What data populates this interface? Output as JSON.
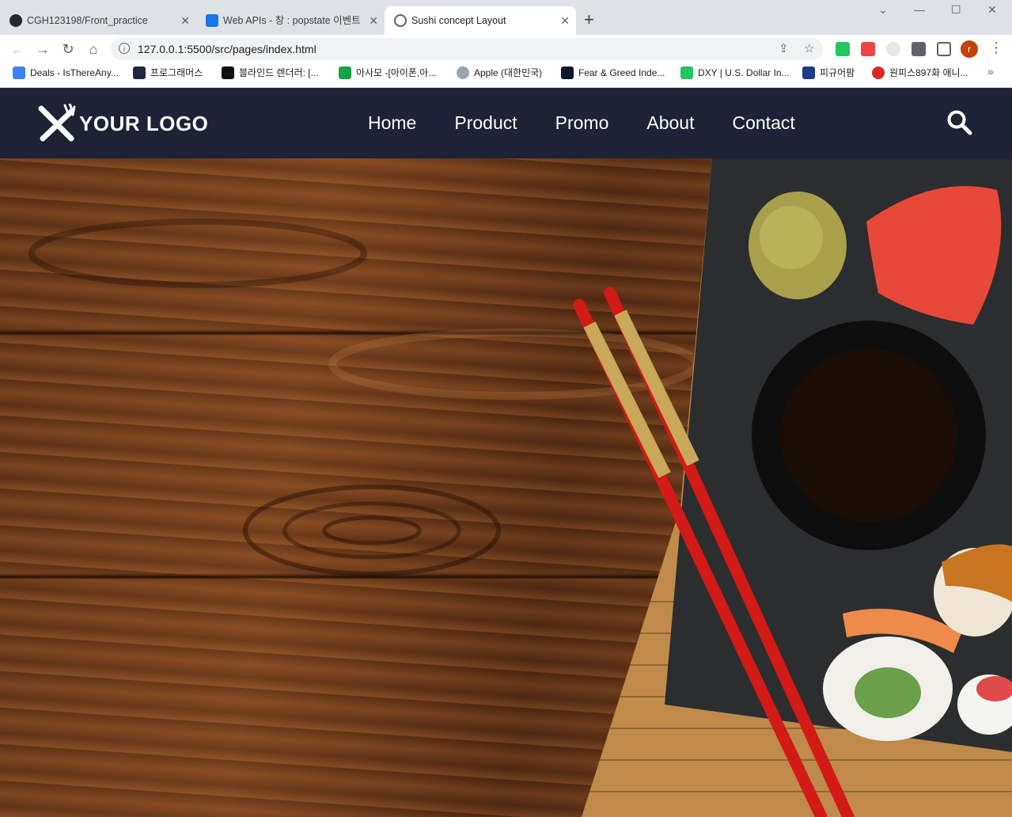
{
  "browser": {
    "tabs": [
      {
        "title": "CGH123198/Front_practice",
        "favicon_color": "#24292f",
        "active": false
      },
      {
        "title": "Web APIs - 창 : popstate 이벤트",
        "favicon_color": "#1a73e8",
        "active": false
      },
      {
        "title": "Sushi concept Layout",
        "favicon_color": "#5f6368",
        "active": true
      }
    ],
    "new_tab_label": "+",
    "window_controls": {
      "dropdown": "⌄",
      "minimize": "—",
      "maximize": "☐",
      "close": "✕"
    },
    "url": "127.0.0.1:5500/src/pages/index.html",
    "profile_initial": "r",
    "bookmarks": [
      {
        "label": "Deals - IsThereAny...",
        "icon_color": "#3b82f6"
      },
      {
        "label": "프로그래머스",
        "icon_color": "#1e293b"
      },
      {
        "label": "블라인드 렌더러: [...",
        "icon_color": "#111111"
      },
      {
        "label": "아사모 -[아이폰,아...",
        "icon_color": "#16a34a"
      },
      {
        "label": "Apple (대한민국)",
        "icon_color": "#9ca3af"
      },
      {
        "label": "Fear & Greed Inde...",
        "icon_color": "#0f172a"
      },
      {
        "label": "DXY | U.S. Dollar In...",
        "icon_color": "#22c55e"
      },
      {
        "label": "피규어팜",
        "icon_color": "#1e3a8a"
      },
      {
        "label": "원피스897화 애니...",
        "icon_color": "#dc2626"
      }
    ],
    "bookmarks_more": "»"
  },
  "site": {
    "logo_text": "YOUR LOGO",
    "nav": [
      "Home",
      "Product",
      "Promo",
      "About",
      "Contact"
    ],
    "header_color": "#1d2234"
  }
}
